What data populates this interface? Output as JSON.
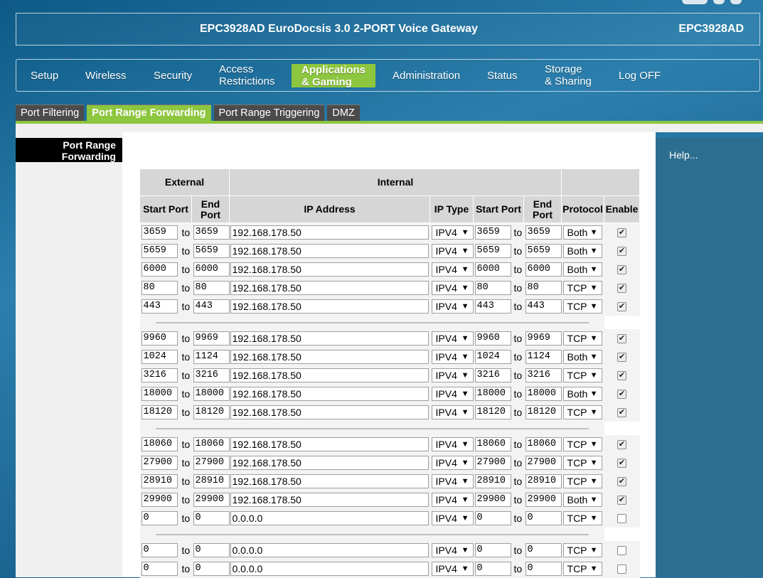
{
  "header": {
    "title": "EPC3928AD EuroDocsis 3.0 2-PORT Voice Gateway",
    "model": "EPC3928AD"
  },
  "nav": [
    {
      "label": "Setup",
      "active": false
    },
    {
      "label": "Wireless",
      "active": false
    },
    {
      "label": "Security",
      "active": false
    },
    {
      "label": "Access\nRestrictions",
      "active": false
    },
    {
      "label": "Applications\n& Gaming",
      "active": true
    },
    {
      "label": "Administration",
      "active": false
    },
    {
      "label": "Status",
      "active": false
    },
    {
      "label": "Storage\n& Sharing",
      "active": false
    },
    {
      "label": "Log OFF",
      "active": false
    }
  ],
  "subtabs": [
    {
      "label": "Port Filtering",
      "active": false
    },
    {
      "label": "Port Range Forwarding",
      "active": true
    },
    {
      "label": "Port Range Triggering",
      "active": false
    },
    {
      "label": "DMZ",
      "active": false
    }
  ],
  "section_label": "Port Range\nForwarding",
  "help_label": "Help...",
  "table": {
    "group_external": "External",
    "group_internal": "Internal",
    "col_start_port": "Start Port",
    "col_end_port": "End\nPort",
    "col_ip": "IP Address",
    "col_ip_type": "IP Type",
    "col_protocol": "Protocol",
    "col_enable": "Enable",
    "to_label": "to",
    "rows": [
      {
        "ext_start": "3659",
        "ext_end": "3659",
        "ip": "192.168.178.50",
        "ip_type": "IPV4",
        "int_start": "3659",
        "int_end": "3659",
        "protocol": "Both",
        "enabled": true
      },
      {
        "ext_start": "5659",
        "ext_end": "5659",
        "ip": "192.168.178.50",
        "ip_type": "IPV4",
        "int_start": "5659",
        "int_end": "5659",
        "protocol": "Both",
        "enabled": true
      },
      {
        "ext_start": "6000",
        "ext_end": "6000",
        "ip": "192.168.178.50",
        "ip_type": "IPV4",
        "int_start": "6000",
        "int_end": "6000",
        "protocol": "Both",
        "enabled": true
      },
      {
        "ext_start": "80",
        "ext_end": "80",
        "ip": "192.168.178.50",
        "ip_type": "IPV4",
        "int_start": "80",
        "int_end": "80",
        "protocol": "TCP",
        "enabled": true
      },
      {
        "ext_start": "443",
        "ext_end": "443",
        "ip": "192.168.178.50",
        "ip_type": "IPV4",
        "int_start": "443",
        "int_end": "443",
        "protocol": "TCP",
        "enabled": true
      },
      {
        "separator": true
      },
      {
        "ext_start": "9960",
        "ext_end": "9969",
        "ip": "192.168.178.50",
        "ip_type": "IPV4",
        "int_start": "9960",
        "int_end": "9969",
        "protocol": "TCP",
        "enabled": true
      },
      {
        "ext_start": "1024",
        "ext_end": "1124",
        "ip": "192.168.178.50",
        "ip_type": "IPV4",
        "int_start": "1024",
        "int_end": "1124",
        "protocol": "Both",
        "enabled": true
      },
      {
        "ext_start": "3216",
        "ext_end": "3216",
        "ip": "192.168.178.50",
        "ip_type": "IPV4",
        "int_start": "3216",
        "int_end": "3216",
        "protocol": "TCP",
        "enabled": true
      },
      {
        "ext_start": "18000",
        "ext_end": "18000",
        "ip": "192.168.178.50",
        "ip_type": "IPV4",
        "int_start": "18000",
        "int_end": "18000",
        "protocol": "Both",
        "enabled": true
      },
      {
        "ext_start": "18120",
        "ext_end": "18120",
        "ip": "192.168.178.50",
        "ip_type": "IPV4",
        "int_start": "18120",
        "int_end": "18120",
        "protocol": "TCP",
        "enabled": true
      },
      {
        "separator": true
      },
      {
        "ext_start": "18060",
        "ext_end": "18060",
        "ip": "192.168.178.50",
        "ip_type": "IPV4",
        "int_start": "18060",
        "int_end": "18060",
        "protocol": "TCP",
        "enabled": true
      },
      {
        "ext_start": "27900",
        "ext_end": "27900",
        "ip": "192.168.178.50",
        "ip_type": "IPV4",
        "int_start": "27900",
        "int_end": "27900",
        "protocol": "TCP",
        "enabled": true
      },
      {
        "ext_start": "28910",
        "ext_end": "28910",
        "ip": "192.168.178.50",
        "ip_type": "IPV4",
        "int_start": "28910",
        "int_end": "28910",
        "protocol": "TCP",
        "enabled": true
      },
      {
        "ext_start": "29900",
        "ext_end": "29900",
        "ip": "192.168.178.50",
        "ip_type": "IPV4",
        "int_start": "29900",
        "int_end": "29900",
        "protocol": "Both",
        "enabled": true
      },
      {
        "ext_start": "0",
        "ext_end": "0",
        "ip": "0.0.0.0",
        "ip_type": "IPV4",
        "int_start": "0",
        "int_end": "0",
        "protocol": "TCP",
        "enabled": false
      },
      {
        "separator": true
      },
      {
        "ext_start": "0",
        "ext_end": "0",
        "ip": "0.0.0.0",
        "ip_type": "IPV4",
        "int_start": "0",
        "int_end": "0",
        "protocol": "TCP",
        "enabled": false
      },
      {
        "ext_start": "0",
        "ext_end": "0",
        "ip": "0.0.0.0",
        "ip_type": "IPV4",
        "int_start": "0",
        "int_end": "0",
        "protocol": "TCP",
        "enabled": false
      }
    ]
  }
}
